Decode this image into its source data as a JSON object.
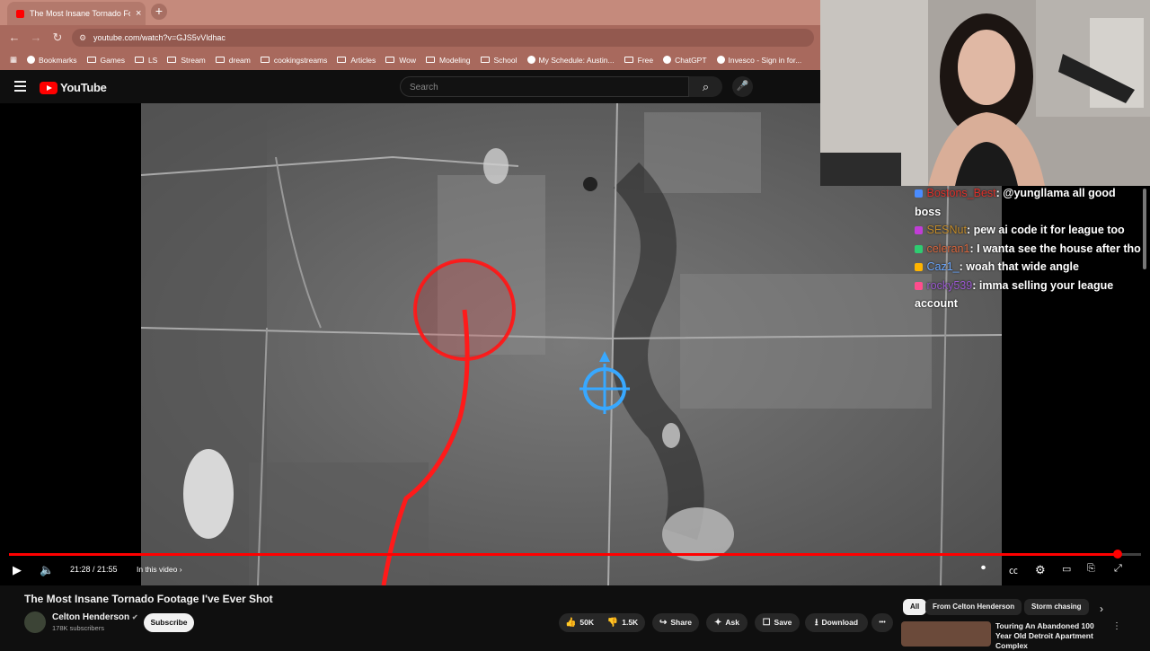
{
  "browser": {
    "tab_title": "The Most Insane Tornado Footage",
    "tab_close": "×",
    "new_tab": "+",
    "url": "youtube.com/watch?v=GJS5vVldhac",
    "bookmarks": [
      "Bookmarks",
      "Games",
      "LS",
      "Stream",
      "dream",
      "cookingstreams",
      "Articles",
      "Wow",
      "Modeling",
      "School",
      "My Schedule: Austin...",
      "Free",
      "ChatGPT",
      "Invesco - Sign in for..."
    ]
  },
  "youtube": {
    "logo": "YouTube",
    "search_placeholder": "Search"
  },
  "player": {
    "time": "21:28 / 21:55",
    "chapters_label": "In this video ›",
    "progress_fraction": 0.979
  },
  "chat": [
    {
      "user": "Bostons_Best",
      "color": "#e0302a",
      "text": "@yungllama all good boss"
    },
    {
      "user": "SESNut",
      "color": "#c28b2a",
      "text": "pew ai code it for league too"
    },
    {
      "user": "celeran1",
      "color": "#d9663d",
      "text": "I wanta see the house after tho"
    },
    {
      "user": "Caz1_",
      "color": "#6aa7ff",
      "text": "woah that wide angle"
    },
    {
      "user": "rocky539",
      "color": "#9b59d0",
      "text": "imma selling your league account"
    }
  ],
  "video": {
    "title": "The Most Insane Tornado Footage I've Ever Shot",
    "channel": "Celton Henderson",
    "subscribers": "178K subscribers",
    "subscribe_label": "Subscribe",
    "likes": "50K",
    "dislikes": "1.5K",
    "share": "Share",
    "ask": "Ask",
    "save": "Save",
    "download": "Download",
    "more": "•••"
  },
  "recommendations": {
    "chips": [
      "All",
      "From Celton Henderson",
      "Storm chasing"
    ],
    "first_title": "Touring An Abandoned 100 Year Old Detroit Apartment Complex"
  }
}
